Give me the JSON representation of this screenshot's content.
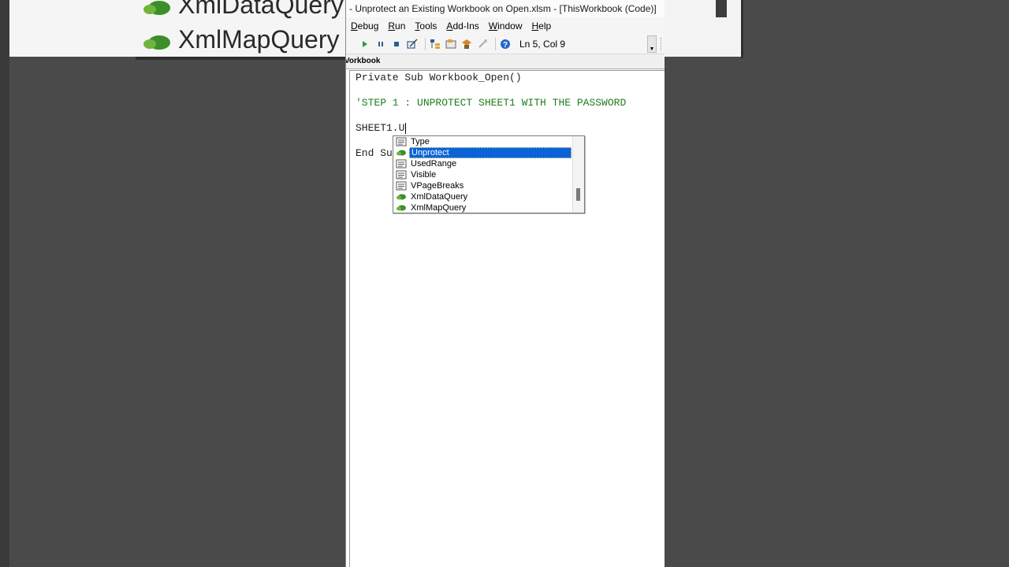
{
  "background": {
    "items": [
      {
        "label": "XmlDataQuery",
        "icon": "method-icon"
      },
      {
        "label": "XmlMapQuery",
        "icon": "method-icon"
      }
    ]
  },
  "window": {
    "title": "- Unprotect an Existing Workbook on Open.xlsm - [ThisWorkbook (Code)]"
  },
  "menu": {
    "items": [
      {
        "label": "Debug",
        "accel": "D",
        "rest": "ebug"
      },
      {
        "label": "Run",
        "accel": "R",
        "rest": "un"
      },
      {
        "label": "Tools",
        "accel": "T",
        "rest": "ools"
      },
      {
        "label": "Add-Ins",
        "accel": "A",
        "rest": "dd-Ins"
      },
      {
        "label": "Window",
        "accel": "W",
        "rest": "indow"
      },
      {
        "label": "Help",
        "accel": "H",
        "rest": "elp"
      }
    ]
  },
  "toolbar": {
    "status": "Ln 5, Col 9",
    "buttons": [
      "run-icon",
      "pause-icon",
      "stop-icon",
      "design-mode-icon",
      "project-explorer-icon",
      "properties-icon",
      "object-browser-icon",
      "toolbox-icon",
      "help-icon"
    ]
  },
  "code_window": {
    "object_label": "Vorkbook"
  },
  "code": {
    "line1": "Private Sub Workbook_Open()",
    "line2": "'STEP 1 : UNPROTECT SHEET1 WITH THE PASSWORD",
    "line3": "SHEET1.U",
    "line4": "End Sub"
  },
  "intellisense": {
    "items": [
      {
        "label": "Type",
        "icon": "property-icon",
        "selected": false
      },
      {
        "label": "Unprotect",
        "icon": "method-icon",
        "selected": true
      },
      {
        "label": "UsedRange",
        "icon": "property-icon",
        "selected": false
      },
      {
        "label": "Visible",
        "icon": "property-icon",
        "selected": false
      },
      {
        "label": "VPageBreaks",
        "icon": "property-icon",
        "selected": false
      },
      {
        "label": "XmlDataQuery",
        "icon": "method-icon",
        "selected": false
      },
      {
        "label": "XmlMapQuery",
        "icon": "method-icon",
        "selected": false
      }
    ],
    "selection_color": "#0a64d8"
  }
}
